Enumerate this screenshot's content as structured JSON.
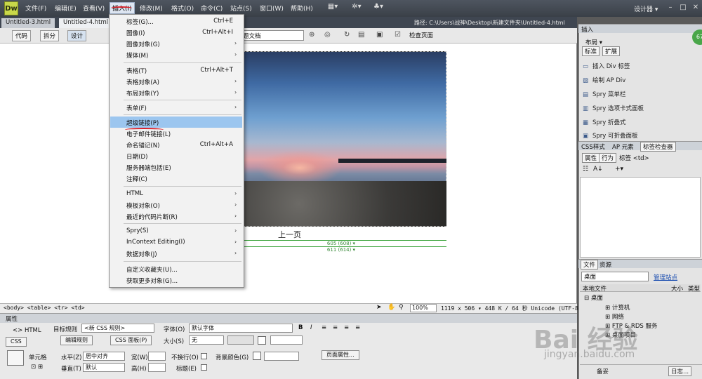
{
  "app": {
    "logo": "Dw"
  },
  "menubar": {
    "items": [
      "文件(F)",
      "编辑(E)",
      "查看(V)",
      "插入(I)",
      "修改(M)",
      "格式(O)",
      "命令(C)",
      "站点(S)",
      "窗口(W)",
      "帮助(H)"
    ],
    "active_index": 3,
    "designer": "设计器 ▾",
    "window_buttons": [
      "–",
      "□",
      "✕"
    ]
  },
  "doc_tabs": [
    "Untitled-3.html",
    "Untitled-4.html"
  ],
  "path": "路径: C:\\Users\\战神\\Desktop\\新建文件夹\\Untitled-4.html",
  "doc_toolbar": {
    "code": "代码",
    "split": "拆分",
    "design": "设计",
    "title_value": "无标题文档",
    "check_page": "检查页面"
  },
  "design": {
    "prev_link": "上一页",
    "width1": "605 (608) ▾",
    "width2": "611 (614) ▾"
  },
  "insert_menu": {
    "items": [
      {
        "label": "标签(G)...",
        "shortcut": "Ctrl+E"
      },
      {
        "label": "图像(I)",
        "shortcut": "Ctrl+Alt+I"
      },
      {
        "label": "图像对象(G)",
        "submenu": true
      },
      {
        "label": "媒体(M)",
        "submenu": true
      },
      {
        "label": "表格(T)",
        "shortcut": "Ctrl+Alt+T"
      },
      {
        "label": "表格对象(A)",
        "submenu": true
      },
      {
        "label": "布局对象(Y)",
        "submenu": true
      },
      {
        "label": "表单(F)",
        "submenu": true
      },
      {
        "label": "超级链接(P)",
        "highlighted": true
      },
      {
        "label": "电子邮件链接(L)"
      },
      {
        "label": "命名锚记(N)",
        "shortcut": "Ctrl+Alt+A"
      },
      {
        "label": "日期(D)"
      },
      {
        "label": "服务器端包括(E)"
      },
      {
        "label": "注释(C)"
      },
      {
        "label": "HTML",
        "submenu": true
      },
      {
        "label": "模板对象(O)",
        "submenu": true
      },
      {
        "label": "最近的代码片断(R)",
        "submenu": true
      },
      {
        "label": "Spry(S)",
        "submenu": true
      },
      {
        "label": "InContext Editing(I)",
        "submenu": true
      },
      {
        "label": "数据对象(J)",
        "submenu": true
      },
      {
        "label": "自定义收藏夹(U)..."
      },
      {
        "label": "获取更多对象(G)..."
      }
    ]
  },
  "status": {
    "tag_path": "<body> <table> <tr> <td>",
    "zoom": "100%",
    "info": "1119 x 506 ▾ 448 K / 64 秒 Unicode (UTF-8)"
  },
  "properties": {
    "header": "属性",
    "html_tab": "<> HTML",
    "css_tab": "CSS",
    "target_rule_label": "目标规则",
    "target_rule_value": "<新 CSS 规则>",
    "font_label": "字体(O)",
    "font_value": "默认字体",
    "edit_rule": "编辑规则",
    "css_panel": "CSS 面板(P)",
    "size_label": "大小(S)",
    "size_value": "无",
    "cell_label": "单元格",
    "horiz_label": "水平(Z)",
    "horiz_value": "居中对齐",
    "width_label": "宽(W)",
    "nowrap_label": "不换行(O)",
    "bg_label": "背景颜色(G)",
    "page_props": "页面属性...",
    "vert_label": "垂直(T)",
    "vert_value": "默认",
    "height_label": "高(H)",
    "header_label": "标题(E)",
    "bold": "B",
    "italic": "I"
  },
  "right_panel": {
    "insert_head": "插入",
    "layout_select": "布局 ▾",
    "tab_standard": "标准",
    "tab_expand": "扩展",
    "insert_items": [
      "插入 Div 标签",
      "绘制 AP Div",
      "Spry 菜单栏",
      "Spry 选项卡式面板",
      "Spry 折叠式",
      "Spry 可折叠面板"
    ],
    "badge": "67",
    "css_tabs": [
      "CSS样式",
      "AP 元素",
      "标签检查器"
    ],
    "attr_tabs": [
      "属性",
      "行为",
      "标签 <td>"
    ],
    "files_tabs": [
      "文件",
      "资源"
    ],
    "site_select": "桌面",
    "manage_site": "管理站点",
    "file_col_local": "本地文件",
    "file_col_size": "大小",
    "file_col_type": "类型",
    "files": [
      "桌面",
      "计算机",
      "网络",
      "FTP & RDS 服务",
      "桌面项目"
    ],
    "ready": "备妥",
    "log": "日志..."
  },
  "watermark": {
    "main": "Bai 经验",
    "sub": "jingyan.baidu.com"
  },
  "colors": {
    "highlight": "#9cc6ef",
    "annotation": "#d8202a",
    "app_dark": "#3a4048"
  }
}
